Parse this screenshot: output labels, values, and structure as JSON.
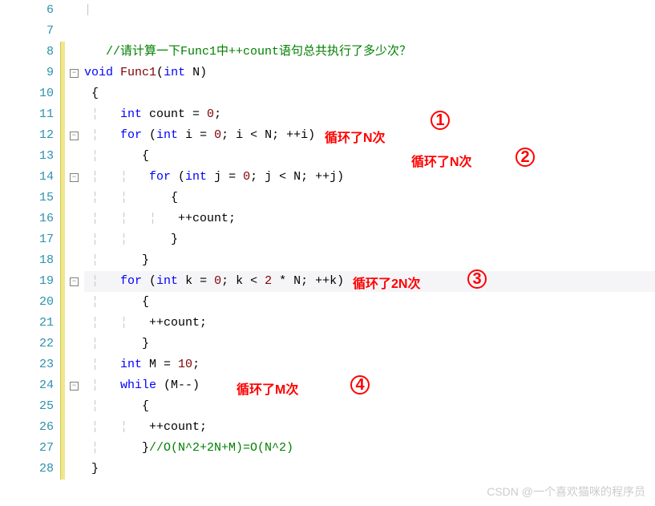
{
  "lines": {
    "6": "6",
    "7": "7",
    "8": "8",
    "9": "9",
    "10": "10",
    "11": "11",
    "12": "12",
    "13": "13",
    "14": "14",
    "15": "15",
    "16": "16",
    "17": "17",
    "18": "18",
    "19": "19",
    "20": "20",
    "21": "21",
    "22": "22",
    "23": "23",
    "24": "24",
    "25": "25",
    "26": "26",
    "27": "27",
    "28": "28"
  },
  "code": {
    "l8_comment": "//请计算一下Func1中++count语句总共执行了多少次？",
    "l9_void": "void",
    "l9_func": "Func1",
    "l9_int": "int",
    "l9_param": " N)",
    "l11_int": "int",
    "l11_rest": " count = ",
    "l11_zero": "0",
    "l11_semi": ";",
    "l12_for": "for",
    "l12_int": "int",
    "l12_a": " (",
    "l12_b": " i = ",
    "l12_zero": "0",
    "l12_c": "; i < N; ++i)",
    "l14_for": "for",
    "l14_int": "int",
    "l14_a": " (",
    "l14_b": " j = ",
    "l14_zero": "0",
    "l14_c": "; j < N; ++j)",
    "l16_stmt": "++count;",
    "l19_for": "for",
    "l19_int": "int",
    "l19_a": " (",
    "l19_b": " k = ",
    "l19_zero": "0",
    "l19_c": "; k < ",
    "l19_two": "2",
    "l19_d": " * N; ++k)",
    "l21_stmt": "++count;",
    "l23_int": "int",
    "l23_rest": " M = ",
    "l23_ten": "10",
    "l23_semi": ";",
    "l24_while": "while",
    "l24_rest": " (M--)",
    "l26_stmt": "++count;",
    "l27_comment": "//O(N^2+2N+M)=O(N^2)"
  },
  "annotations": {
    "a1": "循环了N次",
    "a2": "循环了N次",
    "a3": "循环了2N次",
    "a4": "循环了M次",
    "n1": "1",
    "n2": "2",
    "n3": "3",
    "n4": "4"
  },
  "watermark": "CSDN @一个喜欢猫咪的程序员",
  "fold_minus": "−"
}
